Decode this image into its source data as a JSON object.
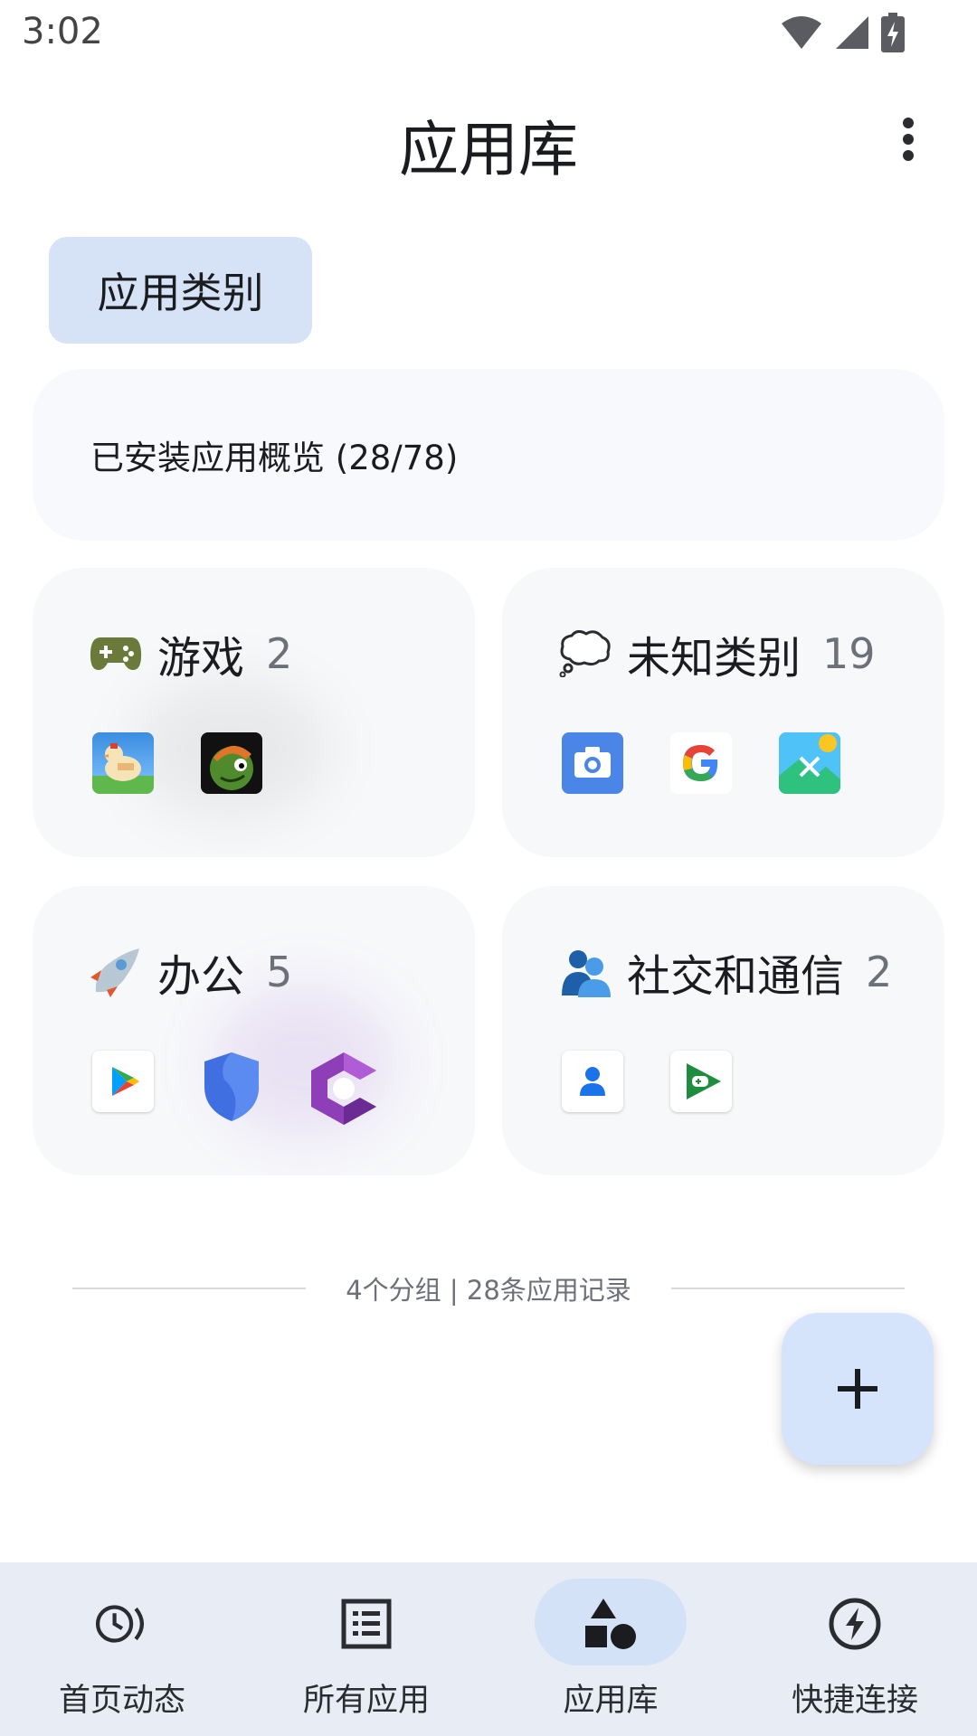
{
  "status_bar": {
    "time": "3:02",
    "icons": [
      "wifi-icon",
      "signal-icon",
      "battery-charging-icon"
    ]
  },
  "header": {
    "title": "应用库",
    "menu_icon": "more-vert-icon"
  },
  "chip": {
    "label": "应用类别"
  },
  "overview": {
    "label": "已安装应用概览 (28/78)"
  },
  "categories": [
    {
      "emoji": "gamepad-icon",
      "title": "游戏",
      "count": "2",
      "apps": [
        "chicken-game-app-icon",
        "frog-game-app-icon"
      ]
    },
    {
      "emoji": "thought-bubble-icon",
      "title": "未知类别",
      "count": "19",
      "apps": [
        "camera-app-icon",
        "google-app-icon",
        "gallery-app-icon"
      ]
    },
    {
      "emoji": "rocket-icon",
      "title": "办公",
      "count": "5",
      "apps": [
        "play-store-app-icon",
        "shield-app-icon",
        "c-logo-app-icon"
      ]
    },
    {
      "emoji": "people-icon",
      "title": "社交和通信",
      "count": "2",
      "apps": [
        "contacts-app-icon",
        "play-games-app-icon"
      ]
    }
  ],
  "summary": {
    "text": "4个分组 | 28条应用记录"
  },
  "fab": {
    "icon": "plus-icon"
  },
  "bottom_nav": {
    "items": [
      {
        "label": "首页动态",
        "icon": "history-icon",
        "active": false
      },
      {
        "label": "所有应用",
        "icon": "list-icon",
        "active": false
      },
      {
        "label": "应用库",
        "icon": "shapes-icon",
        "active": true
      },
      {
        "label": "快捷连接",
        "icon": "bolt-icon",
        "active": false
      }
    ]
  },
  "colors": {
    "chip_bg": "#d6e3f7",
    "nav_bg": "#e7ecf5",
    "active_pill": "#d3e2f6",
    "fab_bg": "#d6e4fb"
  }
}
